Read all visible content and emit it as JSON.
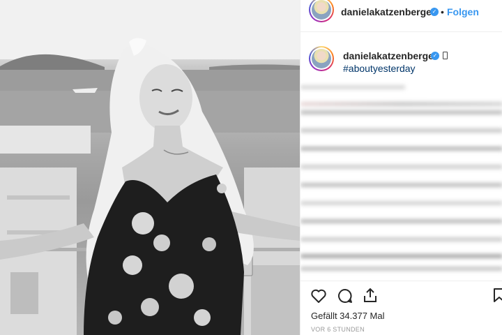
{
  "post": {
    "username": "danielakatzenberger",
    "separator": "•",
    "follow_label": "Folgen",
    "caption_username": "danielakatzenberger",
    "hashtag": "#aboutyesterday",
    "likes": "Gefällt 34.377 Mal",
    "timestamp": "VOR 6 STUNDEN"
  },
  "colors": {
    "accent": "#3897f0",
    "hashtag": "#003569",
    "text": "#262626",
    "muted": "#999999"
  },
  "icons": {
    "like": "heart-icon",
    "comment": "comment-icon",
    "share": "share-icon",
    "save": "bookmark-icon",
    "verified": "verified-badge-icon"
  }
}
